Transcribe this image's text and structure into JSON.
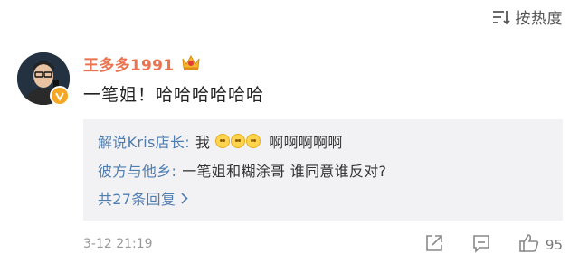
{
  "header": {
    "sort_label": "按热度"
  },
  "comment": {
    "username": "王多多1991",
    "text": "一笔姐！哈哈哈哈哈哈",
    "time": "3-12 21:19",
    "likes": "95"
  },
  "replies": [
    {
      "user": "解说Kris店长:",
      "text_before": "我",
      "text_after": "啊啊啊啊啊",
      "emoji_count": 3
    },
    {
      "user": "彼方与他乡:",
      "text": "一笔姐和糊涂哥 谁同意谁反对?"
    }
  ],
  "more_replies": "共27条回复",
  "colors": {
    "username": "#eb7350",
    "link": "#507daf",
    "reply_bg": "#f2f2f5"
  },
  "icons": [
    "sort-icon",
    "crown-badge-icon",
    "verified-badge-icon",
    "emoji-icon",
    "chevron-right-icon",
    "share-icon",
    "comment-icon",
    "like-icon"
  ]
}
